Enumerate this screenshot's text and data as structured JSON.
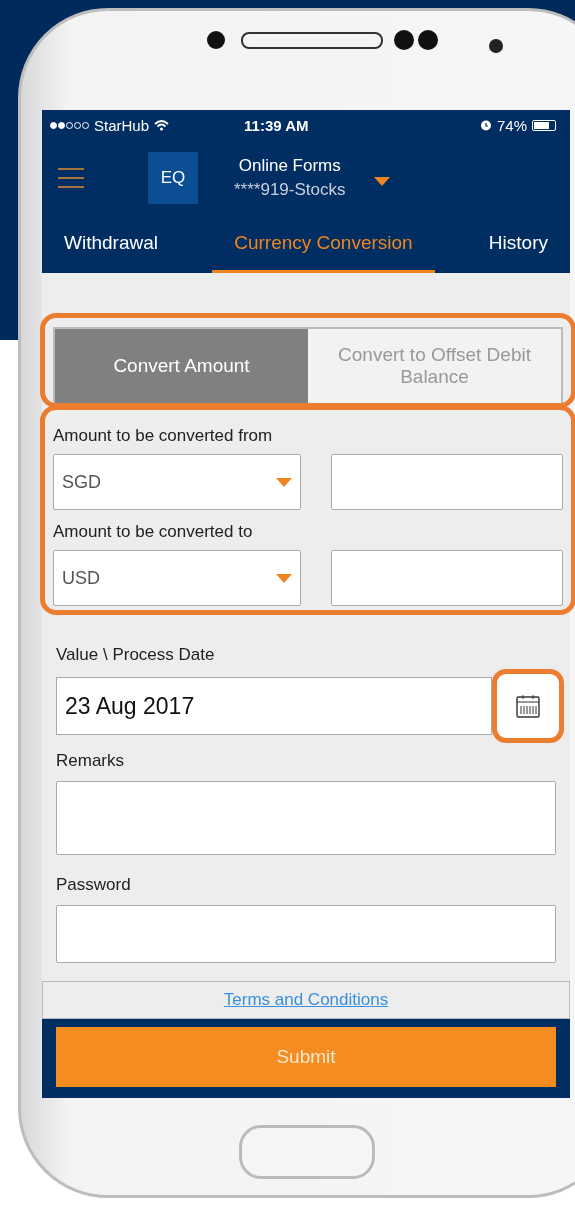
{
  "status_bar": {
    "carrier": "StarHub",
    "time": "11:39 AM",
    "battery": "74%"
  },
  "header": {
    "badge": "EQ",
    "title": "Online Forms",
    "account": "****919-Stocks"
  },
  "tabs": [
    {
      "label": "Withdrawal",
      "selected": false
    },
    {
      "label": "Currency Conversion",
      "selected": true
    },
    {
      "label": "History",
      "selected": false
    }
  ],
  "mode_toggle": [
    {
      "label": "Convert Amount",
      "selected": true
    },
    {
      "label": "Convert to Offset Debit Balance",
      "selected": false
    }
  ],
  "conversion": {
    "from_label": "Amount to be converted from",
    "from_currency": "SGD",
    "to_label": "Amount to be converted to",
    "to_currency": "USD"
  },
  "date": {
    "label": "Value \\ Process Date",
    "value": "23 Aug 2017"
  },
  "remarks": {
    "label": "Remarks"
  },
  "password": {
    "label": "Password"
  },
  "terms_link": "Terms and Conditions",
  "submit_button": "Submit"
}
